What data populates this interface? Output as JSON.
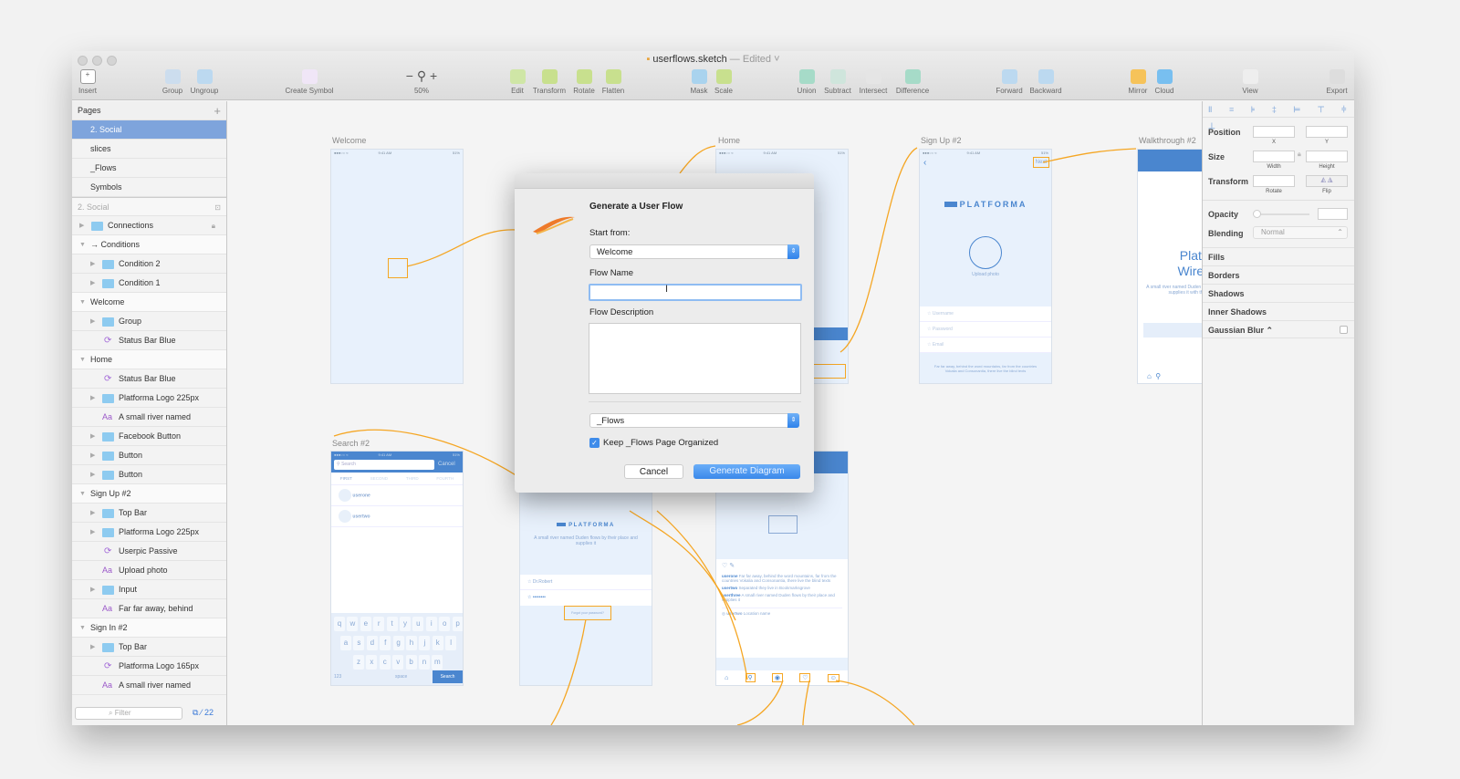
{
  "window": {
    "title": "userflows.sketch",
    "title_status": "— Edited ˅"
  },
  "toolbar": [
    {
      "label": "Insert",
      "icon": "plus-icon"
    },
    {
      "label": "Group",
      "icon": "group-icon"
    },
    {
      "label": "Ungroup",
      "icon": "ungroup-icon"
    },
    {
      "label": "Create Symbol",
      "icon": "symbol-icon"
    },
    {
      "label": "50%",
      "icon": "zoom-icon"
    },
    {
      "label": "Edit",
      "icon": "edit-icon"
    },
    {
      "label": "Transform",
      "icon": "transform-icon"
    },
    {
      "label": "Rotate",
      "icon": "rotate-icon"
    },
    {
      "label": "Flatten",
      "icon": "flatten-icon"
    },
    {
      "label": "Mask",
      "icon": "mask-icon"
    },
    {
      "label": "Scale",
      "icon": "scale-icon"
    },
    {
      "label": "Union",
      "icon": "union-icon"
    },
    {
      "label": "Subtract",
      "icon": "subtract-icon"
    },
    {
      "label": "Intersect",
      "icon": "intersect-icon"
    },
    {
      "label": "Difference",
      "icon": "difference-icon"
    },
    {
      "label": "Forward",
      "icon": "forward-icon"
    },
    {
      "label": "Backward",
      "icon": "backward-icon"
    },
    {
      "label": "Mirror",
      "icon": "mirror-icon"
    },
    {
      "label": "Cloud",
      "icon": "cloud-icon"
    },
    {
      "label": "View",
      "icon": "view-icon"
    },
    {
      "label": "Export",
      "icon": "export-icon"
    }
  ],
  "sidebar": {
    "pages_header": "Pages",
    "pages": [
      "2. Social",
      "slices",
      "_Flows",
      "Symbols"
    ],
    "selected_page": "2. Social",
    "layers_header": "2. Social",
    "layers": [
      {
        "label": "Connections",
        "type": "folder",
        "level": 0,
        "locked": true
      },
      {
        "label": "→ Conditions",
        "type": "group",
        "level": 0
      },
      {
        "label": "Condition 2",
        "type": "folder",
        "level": 1
      },
      {
        "label": "Condition 1",
        "type": "folder",
        "level": 1
      },
      {
        "label": "Welcome",
        "type": "artboard",
        "level": 0
      },
      {
        "label": "Group",
        "type": "folder",
        "level": 1
      },
      {
        "label": "Status Bar Blue",
        "type": "symbol",
        "level": 1
      },
      {
        "label": "Home",
        "type": "artboard",
        "level": 0
      },
      {
        "label": "Status Bar Blue",
        "type": "symbol",
        "level": 1
      },
      {
        "label": "Platforma Logo 225px",
        "type": "folder",
        "level": 1
      },
      {
        "label": "A small river named",
        "type": "text",
        "level": 1
      },
      {
        "label": "Facebook Button",
        "type": "folder",
        "level": 1
      },
      {
        "label": "Button",
        "type": "folder",
        "level": 1
      },
      {
        "label": "Button",
        "type": "folder",
        "level": 1
      },
      {
        "label": "Sign Up #2",
        "type": "artboard",
        "level": 0
      },
      {
        "label": "Top Bar",
        "type": "folder",
        "level": 1
      },
      {
        "label": "Platforma Logo 225px",
        "type": "folder",
        "level": 1
      },
      {
        "label": "Userpic Passive",
        "type": "symbol",
        "level": 1
      },
      {
        "label": "Upload photo",
        "type": "text",
        "level": 1
      },
      {
        "label": "Input",
        "type": "folder",
        "level": 1
      },
      {
        "label": "Far far away, behind",
        "type": "text",
        "level": 1
      },
      {
        "label": "Sign In #2",
        "type": "artboard",
        "level": 0
      },
      {
        "label": "Top Bar",
        "type": "folder",
        "level": 1
      },
      {
        "label": "Platforma Logo 165px",
        "type": "symbol",
        "level": 1
      },
      {
        "label": "A small river named",
        "type": "text",
        "level": 1
      }
    ],
    "filter_placeholder": "Filter",
    "count": "22"
  },
  "canvas": {
    "artboards": {
      "welcome": "Welcome",
      "home": "Home",
      "signup": "Sign Up #2",
      "walkthrough": "Walkthrough #2",
      "search": "Search #2"
    },
    "status_time": "9:41 AM",
    "status_battery": "51%",
    "signup": {
      "next": "Next",
      "brand": "PLATFORMA",
      "upload": "Upload photo",
      "fields": [
        "Username",
        "Password",
        "Email"
      ],
      "footer": "Far far away, behind the word mountains, far from the countries Vokalia and Consonantia, there live the blind texts"
    },
    "walkthrough": {
      "title1": "Platfor",
      "title2": "Wirefra",
      "body": "A small river named Duden flows by their place and supplies it with the necessary",
      "button": "Find"
    },
    "search": {
      "placeholder": "Search",
      "cancel": "Cancel",
      "tabs": [
        "FIRST",
        "SECOND",
        "THIRD",
        "FOURTH"
      ],
      "users": [
        {
          "name": "userone",
          "sub": "User One"
        },
        {
          "name": "usertwo",
          "sub": "User Two"
        }
      ],
      "keys": [
        [
          "q",
          "w",
          "e",
          "r",
          "t",
          "y",
          "u",
          "i",
          "o",
          "p"
        ],
        [
          "a",
          "s",
          "d",
          "f",
          "g",
          "h",
          "j",
          "k",
          "l"
        ],
        [
          "z",
          "x",
          "c",
          "v",
          "b",
          "n",
          "m"
        ]
      ],
      "space": "space",
      "num": "123",
      "search_key": "Search"
    },
    "signin": {
      "brand": "PLATFORMA",
      "tagline": "A small river named Duden flows by their place and supplies it",
      "user": "Dr.Robert",
      "password": "••••••••",
      "forgot": "Forgot your password?"
    },
    "feed": {
      "posts": [
        {
          "user": "userone",
          "text": "Far far away, behind the word mountains, far from the countries Vokalia and Consonantia, there live the blind texts"
        },
        {
          "user": "usertwo",
          "text": "Separated they live in Bookmarksgrove"
        },
        {
          "user": "userthree",
          "text": "A small river named Duden flows by their place and supplies it"
        }
      ],
      "author": "usertwo",
      "location": "Location name"
    }
  },
  "dialog": {
    "title": "Generate a User Flow",
    "start_label": "Start from:",
    "start_value": "Welcome",
    "name_label": "Flow Name",
    "name_value": "",
    "desc_label": "Flow Description",
    "desc_value": "",
    "page_value": "_Flows",
    "keep_label": "Keep _Flows Page Organized",
    "keep_checked": true,
    "cancel": "Cancel",
    "generate": "Generate Diagram"
  },
  "inspector": {
    "position": "Position",
    "x": "X",
    "y": "Y",
    "size": "Size",
    "width": "Width",
    "height": "Height",
    "transform": "Transform",
    "rotate": "Rotate",
    "flip": "Flip",
    "opacity": "Opacity",
    "opacity_value": 0,
    "blending": "Blending",
    "blending_value": "Normal",
    "fills": "Fills",
    "borders": "Borders",
    "shadows": "Shadows",
    "inner_shadows": "Inner Shadows",
    "gaussian_blur": "Gaussian Blur ⌃"
  },
  "colors": {
    "accent": "#7ea4dc",
    "flow_line": "#f5a623",
    "primary_button": "#3b8beb",
    "artboard_blue": "#4a86cf"
  }
}
